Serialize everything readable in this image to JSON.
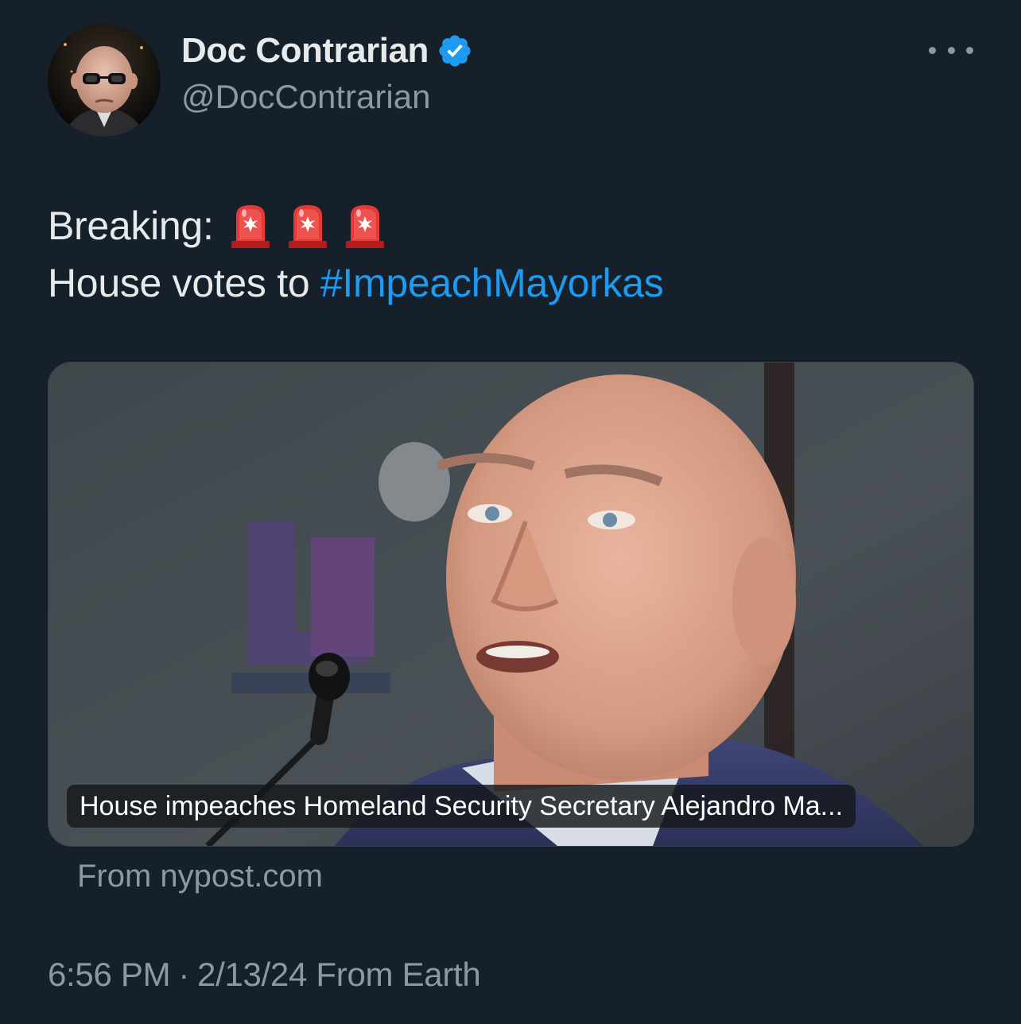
{
  "author": {
    "display_name": "Doc Contrarian",
    "handle": "@DocContrarian",
    "verified": true
  },
  "tweet": {
    "line1_prefix": "Breaking:",
    "line1_icons": [
      "siren-icon",
      "siren-icon",
      "siren-icon"
    ],
    "line2_prefix": "House votes to ",
    "hashtag": "#ImpeachMayorkas"
  },
  "card": {
    "caption": "House impeaches Homeland Security Secretary Alejandro Ma...",
    "source": "From nypost.com"
  },
  "meta": {
    "time": "6:56 PM",
    "separator": "·",
    "date": "2/13/24",
    "source": "From Earth"
  },
  "colors": {
    "background": "#15202b",
    "text": "#e7e9ea",
    "secondary": "#8b98a5",
    "accent": "#1d9bf0"
  }
}
